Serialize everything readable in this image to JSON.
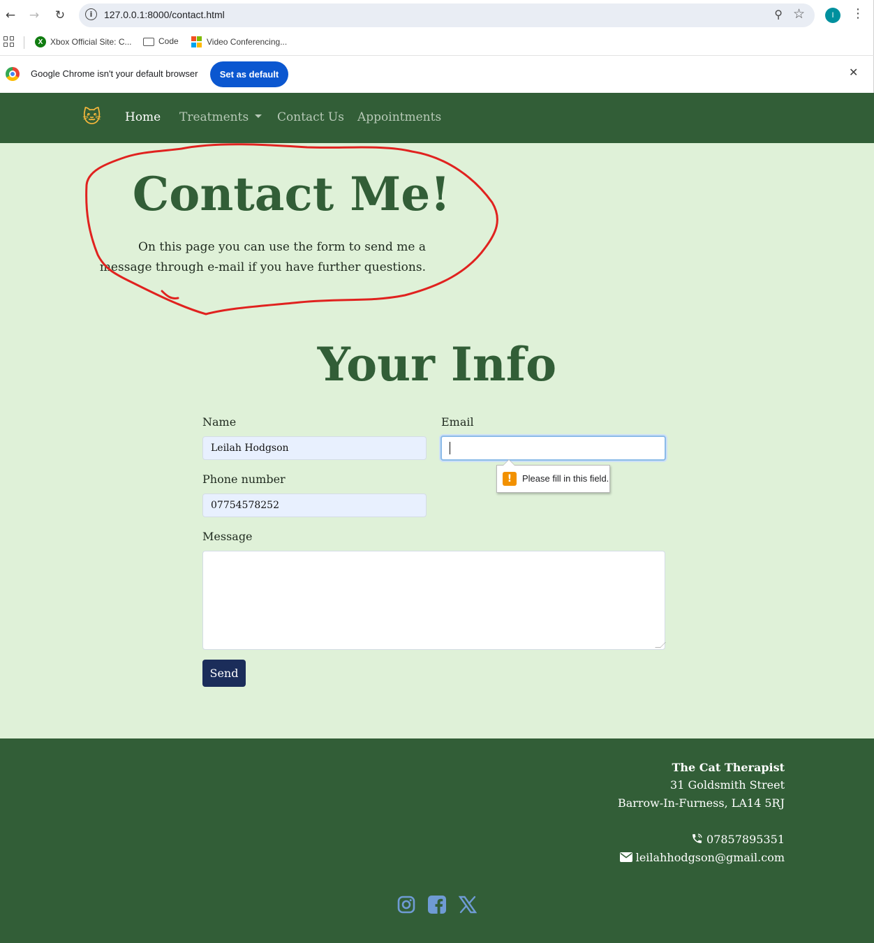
{
  "browser": {
    "url": "127.0.0.1:8000/contact.html",
    "profile_initial": "I",
    "bookmarks": [
      {
        "label": "Xbox Official Site: C...",
        "icon": "xbox-icon"
      },
      {
        "label": "Code",
        "icon": "folder-icon"
      },
      {
        "label": "Video Conferencing...",
        "icon": "microsoft-icon"
      }
    ],
    "infobar": {
      "message": "Google Chrome isn't your default browser",
      "button": "Set as default"
    }
  },
  "nav": {
    "brand_icon": "cat-face-icon",
    "items": [
      {
        "label": "Home",
        "active": true
      },
      {
        "label": "Treatments",
        "dropdown": true
      },
      {
        "label": "Contact Us"
      },
      {
        "label": "Appointments"
      }
    ]
  },
  "hero": {
    "title": "Contact Me!",
    "text": "On this page you can use the form to send me a message through e-mail if you have further questions."
  },
  "form": {
    "title": "Your Info",
    "name_label": "Name",
    "name_value": "Leilah Hodgson",
    "email_label": "Email",
    "email_value": "",
    "phone_label": "Phone number",
    "phone_value": "07754578252",
    "message_label": "Message",
    "message_value": "",
    "send_label": "Send",
    "validation_message": "Please fill in this field."
  },
  "footer": {
    "business_name": "The Cat Therapist",
    "street": "31 Goldsmith Street",
    "city": "Barrow-In-Furness, LA14 5RJ",
    "phone": "07857895351",
    "email": "leilahhodgson@gmail.com",
    "socials": [
      "instagram-icon",
      "facebook-icon",
      "x-twitter-icon"
    ]
  },
  "colors": {
    "nav_bg": "#325e37",
    "page_bg": "#dff1d8",
    "heading": "#325e37",
    "send_button": "#1b2d5a",
    "annotation": "#e0221f",
    "social_icons": "#6f9bd4"
  }
}
